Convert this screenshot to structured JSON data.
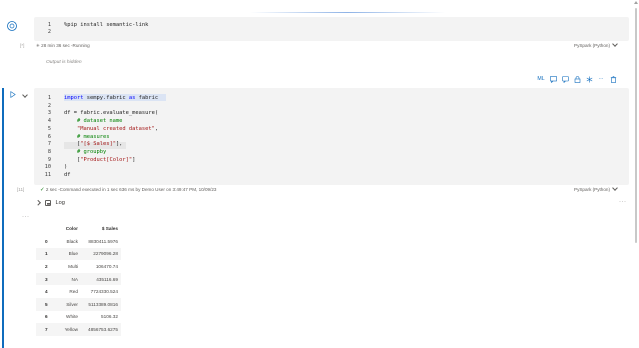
{
  "cell1": {
    "lines": [
      {
        "n": "1",
        "code": "%pip install semantic-link"
      },
      {
        "n": "2",
        "code": ""
      }
    ],
    "exec_count": "[*]",
    "status": "28 min 36 sec -Running",
    "language": "PySpark (Python)",
    "output_hidden": "Output is hidden"
  },
  "toolbar": {
    "ml_label": "ML",
    "more_label": "···"
  },
  "cell2": {
    "lines": [
      {
        "n": "1",
        "code": "import sempy.fabric as fabric"
      },
      {
        "n": "2",
        "code": ""
      },
      {
        "n": "3",
        "code": "df = fabric.evaluate_measure("
      },
      {
        "n": "4",
        "code": "    # dataset name"
      },
      {
        "n": "5",
        "code": "    \"Manual created dataset\","
      },
      {
        "n": "6",
        "code": "    # measures"
      },
      {
        "n": "7",
        "code": "    [\"[$ Sales]\"],"
      },
      {
        "n": "8",
        "code": "    # groupby"
      },
      {
        "n": "9",
        "code": "    [\"Product[Color]\"]"
      },
      {
        "n": "10",
        "code": ")"
      },
      {
        "n": "11",
        "code": "df"
      }
    ],
    "exec_count": "[11]",
    "status": "2 sec -Command executed in 1 sec 636 ms by Demo User on 3:49:47 PM, 10/09/23",
    "language": "PySpark (Python)",
    "log_label": "Log",
    "more_label": "···"
  },
  "output_table": {
    "columns": [
      "",
      "Color",
      "$ Sales"
    ],
    "rows": [
      [
        "0",
        "Black",
        "8830411.5976"
      ],
      [
        "1",
        "Blue",
        "2279096.28"
      ],
      [
        "2",
        "Multi",
        "106470.74"
      ],
      [
        "3",
        "NA",
        "435116.69"
      ],
      [
        "4",
        "Red",
        "7724330.524"
      ],
      [
        "5",
        "Silver",
        "5113389.0816"
      ],
      [
        "6",
        "White",
        "5106.32"
      ],
      [
        "7",
        "Yellow",
        "4856753.6275"
      ]
    ]
  },
  "left_more_label": "···",
  "colors": {
    "accent": "#0f6cbd",
    "cell_bg": "#f3f3f3",
    "keyword": "#0000ff",
    "comment": "#008000",
    "string": "#a31515",
    "success": "#107c10"
  }
}
